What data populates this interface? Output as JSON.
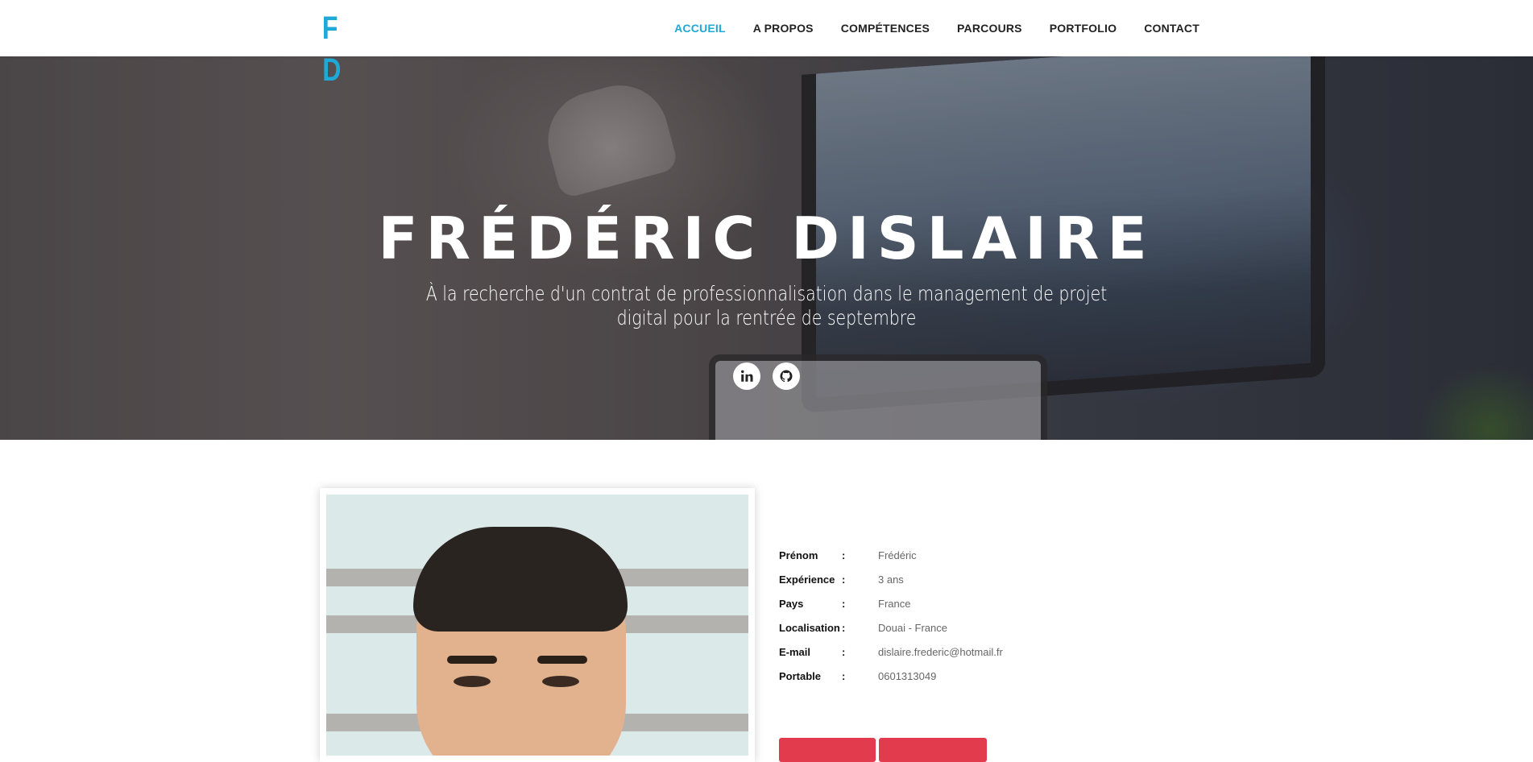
{
  "brand": {
    "logo_letters": "FD",
    "accent_color": "#1fa9d6"
  },
  "nav": {
    "items": [
      {
        "label": "ACCUEIL",
        "active": true
      },
      {
        "label": "A PROPOS",
        "active": false
      },
      {
        "label": "COMPÉTENCES",
        "active": false
      },
      {
        "label": "PARCOURS",
        "active": false
      },
      {
        "label": "PORTFOLIO",
        "active": false
      },
      {
        "label": "CONTACT",
        "active": false
      }
    ]
  },
  "hero": {
    "title": "FRÉDÉRIC DISLAIRE",
    "subtitle": "À la recherche d'un contrat de professionnalisation dans le management de projet digital pour la rentrée de septembre",
    "social": [
      {
        "icon": "linkedin-icon"
      },
      {
        "icon": "github-icon"
      }
    ]
  },
  "about": {
    "details": [
      {
        "label": "Prénom",
        "separator": ":",
        "value": "Frédéric"
      },
      {
        "label": "Expérience",
        "separator": ":",
        "value": "3 ans"
      },
      {
        "label": "Pays",
        "separator": ":",
        "value": "France"
      },
      {
        "label": "Localisation",
        "separator": ":",
        "value": "Douai - France"
      },
      {
        "label": "E-mail",
        "separator": ":",
        "value": "dislaire.frederic@hotmail.fr"
      },
      {
        "label": "Portable",
        "separator": ":",
        "value": "0601313049"
      }
    ],
    "button_color": "#e23b4e"
  }
}
